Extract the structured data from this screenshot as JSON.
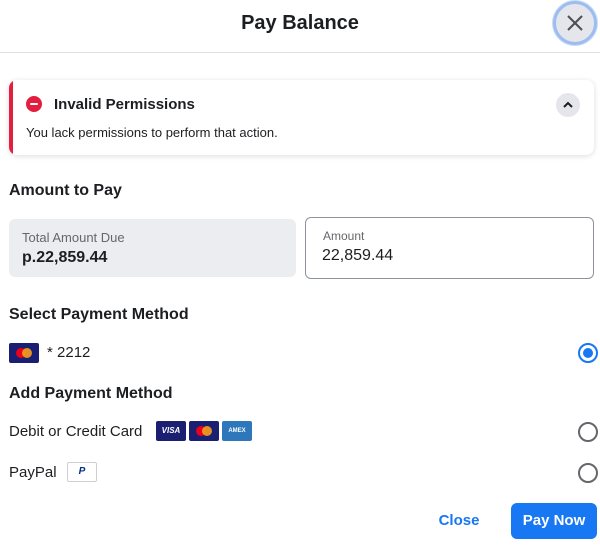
{
  "dialog": {
    "title": "Pay Balance",
    "close_icon": "close-icon"
  },
  "alert": {
    "title": "Invalid Permissions",
    "message": "You lack permissions to perform that action.",
    "icon": "error-icon",
    "toggle_icon": "chevron-up-icon",
    "accent_color": "#e41e3f"
  },
  "amount_section": {
    "heading": "Amount to Pay",
    "total_label": "Total Amount Due",
    "total_value": "p.22,859.44",
    "amount_label": "Amount",
    "amount_value": "22,859.44"
  },
  "select_method": {
    "heading": "Select Payment Method",
    "saved_card": {
      "brand_icon": "mastercard-icon",
      "label": "* 2212",
      "selected": true
    }
  },
  "add_method": {
    "heading": "Add Payment Method",
    "options": [
      {
        "label": "Debit or Credit Card",
        "logos": {
          "visa": "VISA",
          "mastercard": "mastercard-icon",
          "amex": "AMEX"
        },
        "selected": false
      },
      {
        "label": "PayPal",
        "logo": "P",
        "selected": false
      }
    ]
  },
  "footer": {
    "close_label": "Close",
    "pay_label": "Pay Now"
  },
  "colors": {
    "primary": "#1877f2",
    "error": "#e41e3f"
  }
}
